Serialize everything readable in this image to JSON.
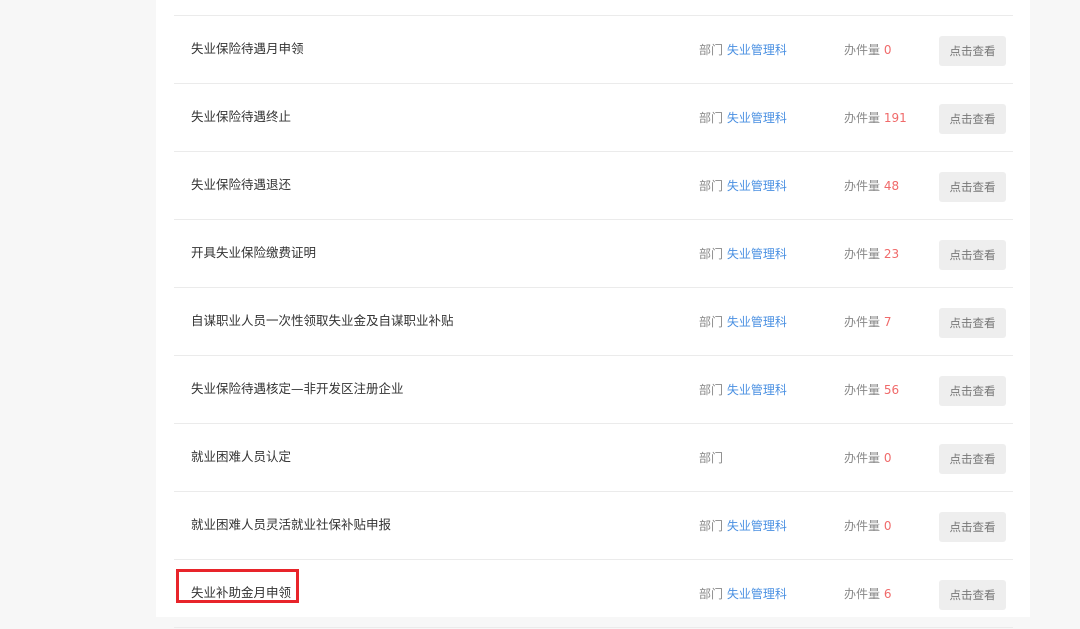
{
  "list": {
    "dept_label": "部门",
    "count_label": "办件量",
    "rows": [
      {
        "title": "失业保险待遇月申领",
        "dept": "失业管理科",
        "count": "0",
        "button": "点击查看"
      },
      {
        "title": "失业保险待遇终止",
        "dept": "失业管理科",
        "count": "191",
        "button": "点击查看"
      },
      {
        "title": "失业保险待遇退还",
        "dept": "失业管理科",
        "count": "48",
        "button": "点击查看"
      },
      {
        "title": "开具失业保险缴费证明",
        "dept": "失业管理科",
        "count": "23",
        "button": "点击查看"
      },
      {
        "title": "自谋职业人员一次性领取失业金及自谋职业补贴",
        "dept": "失业管理科",
        "count": "7",
        "button": "点击查看"
      },
      {
        "title": "失业保险待遇核定—非开发区注册企业",
        "dept": "失业管理科",
        "count": "56",
        "button": "点击查看"
      },
      {
        "title": "就业困难人员认定",
        "dept": "",
        "count": "0",
        "button": "点击查看"
      },
      {
        "title": "就业困难人员灵活就业社保补贴申报",
        "dept": "失业管理科",
        "count": "0",
        "button": "点击查看"
      },
      {
        "title": "失业补助金月申领",
        "dept": "失业管理科",
        "count": "6",
        "button": "点击查看"
      }
    ]
  },
  "colors": {
    "link_blue": "#4a90e2",
    "count_red": "#f06a6a",
    "highlight_red": "#e8242a"
  }
}
